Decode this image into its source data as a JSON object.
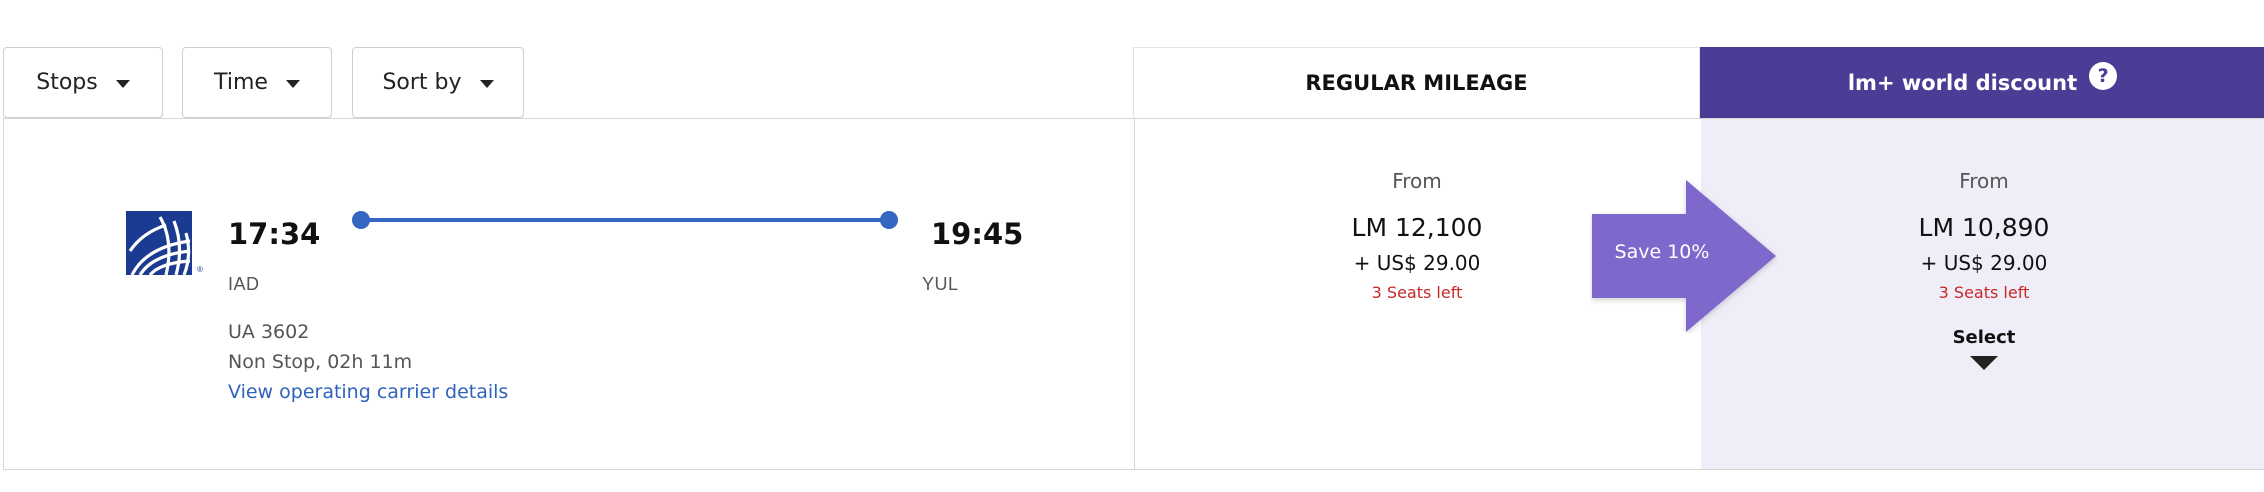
{
  "filters": {
    "stops_label": "Stops",
    "time_label": "Time",
    "sort_label": "Sort by"
  },
  "fare_headers": {
    "regular": "REGULAR MILEAGE",
    "discount": "lm+ world discount",
    "help_glyph": "?"
  },
  "flight": {
    "airline_logo_icon": "united-globe-logo",
    "departure_time": "17:34",
    "arrival_time": "19:45",
    "departure_code": "IAD",
    "arrival_code": "YUL",
    "flight_number": "UA 3602",
    "duration": "Non Stop, 02h 11m",
    "carrier_link": "View operating carrier details"
  },
  "regular_fare": {
    "from": "From",
    "price": "LM 12,100",
    "tax": "+ US$ 29.00",
    "seats": "3 Seats left"
  },
  "discount_fare": {
    "from": "From",
    "price": "LM 10,890",
    "tax": "+ US$ 29.00",
    "seats": "3 Seats left",
    "select_label": "Select"
  },
  "save_badge": "Save 10%",
  "colors": {
    "discount_header": "#4b3d96",
    "discount_panel": "#efeef8",
    "route_line": "#3566c4",
    "save_arrow": "#7f68cc",
    "seats_text": "#c62828",
    "link": "#2f62bd"
  }
}
